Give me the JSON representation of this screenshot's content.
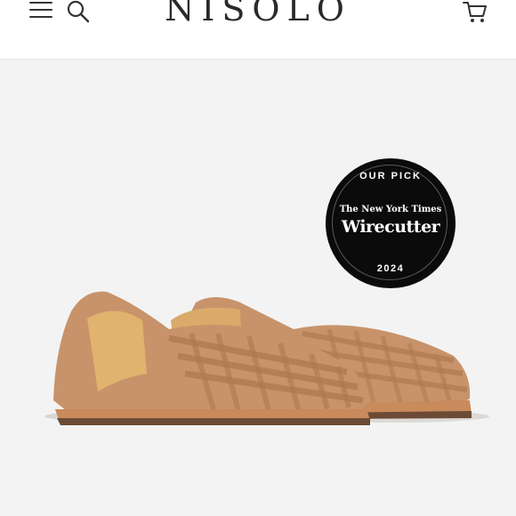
{
  "header": {
    "brand": "NISOLO",
    "menu_icon": "menu-icon",
    "search_icon": "search-icon",
    "cart_icon": "cart-icon"
  },
  "badge": {
    "top_text": "OUR PICK",
    "publisher": "The New York Times",
    "name": "Wirecutter",
    "year": "2024"
  },
  "product": {
    "image": "tan-leather-woven-huarache-sandals"
  },
  "colors": {
    "leather": "#c8936a",
    "leather_dark": "#a8734c",
    "sole": "#6b4b35",
    "badge_bg": "#0b0b0b"
  }
}
